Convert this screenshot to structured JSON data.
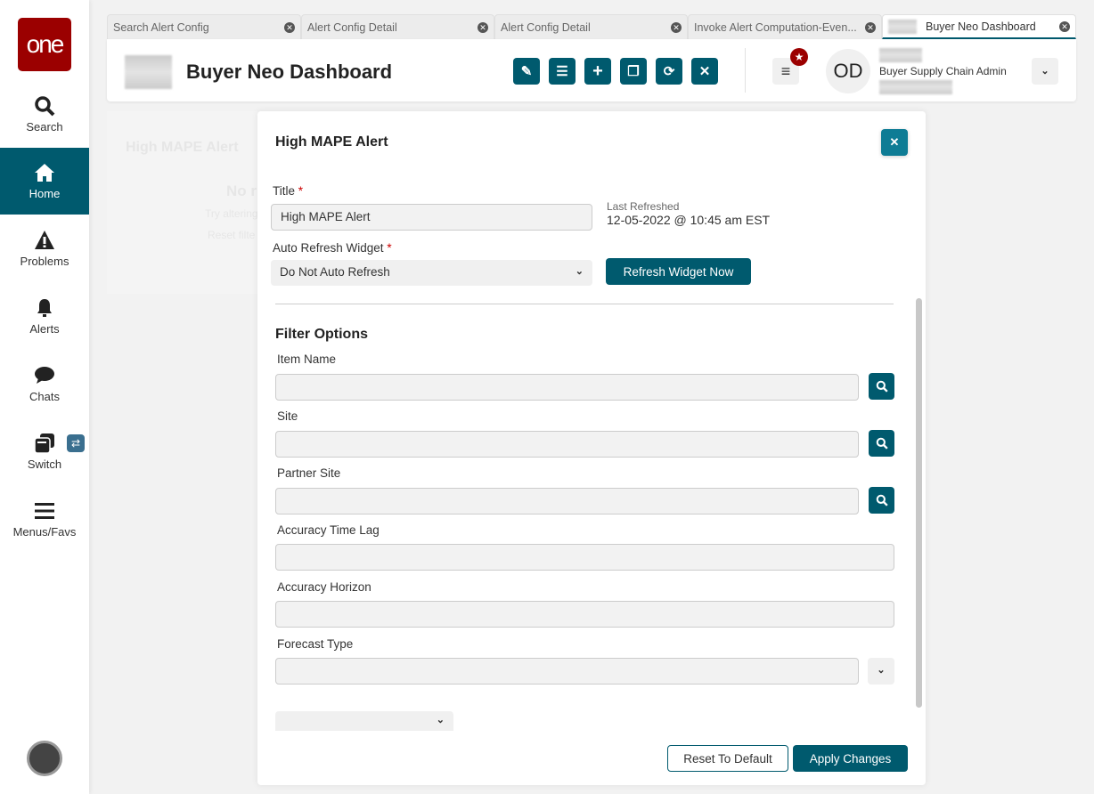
{
  "sidebar": {
    "logo": "one",
    "items": [
      {
        "label": "Search",
        "icon": "search-icon"
      },
      {
        "label": "Home",
        "icon": "home-icon",
        "active": true
      },
      {
        "label": "Problems",
        "icon": "warning-icon"
      },
      {
        "label": "Alerts",
        "icon": "bell-icon"
      },
      {
        "label": "Chats",
        "icon": "chat-icon"
      },
      {
        "label": "Switch",
        "icon": "switch-icon"
      },
      {
        "label": "Menus/Favs",
        "icon": "menu-icon"
      }
    ]
  },
  "tabs": [
    {
      "label": "Search Alert Config"
    },
    {
      "label": "Alert Config Detail"
    },
    {
      "label": "Alert Config Detail"
    },
    {
      "label": "Invoke Alert Computation-Even..."
    },
    {
      "label": "Buyer Neo Dashboard",
      "active": true
    }
  ],
  "header": {
    "title": "Buyer Neo Dashboard",
    "user_initials": "OD",
    "user_role": "Buyer Supply Chain Admin"
  },
  "background_widget": {
    "title": "High MAPE Alert",
    "empty_title": "No r",
    "empty_hint": "Try altering",
    "reset_link": "Reset filte"
  },
  "modal": {
    "title": "High MAPE Alert",
    "title_label": "Title",
    "title_value": "High MAPE Alert",
    "required_mark": "*",
    "last_refreshed_label": "Last Refreshed",
    "last_refreshed_value": "12-05-2022 @ 10:45 am EST",
    "auto_refresh_label": "Auto Refresh Widget",
    "auto_refresh_value": "Do Not Auto Refresh",
    "refresh_now": "Refresh Widget Now",
    "filter_heading": "Filter Options",
    "fields": {
      "item_name": "Item Name",
      "site": "Site",
      "partner_site": "Partner Site",
      "accuracy_time_lag": "Accuracy Time Lag",
      "accuracy_horizon": "Accuracy Horizon",
      "forecast_type": "Forecast Type"
    },
    "reset": "Reset To Default",
    "apply": "Apply Changes"
  },
  "colors": {
    "primary": "#005a6e",
    "logo": "#9b0000",
    "close": "#0e7c95"
  }
}
